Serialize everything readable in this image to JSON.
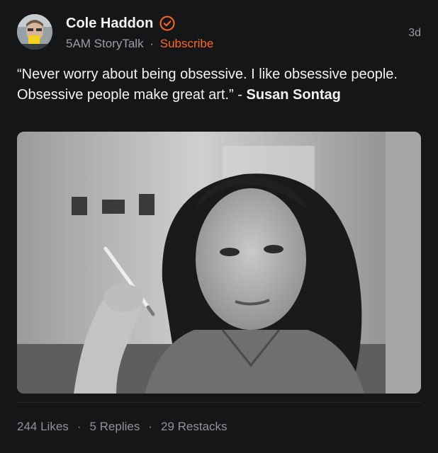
{
  "author": {
    "name": "Cole Haddon",
    "publication": "5AM StoryTalk",
    "subscribe_label": "Subscribe",
    "separator": "·"
  },
  "timestamp": "3d",
  "post": {
    "quote": "“Never worry about being obsessive. I like obsessive people. Obsessive people make great art.” - ",
    "attribution": "Susan Sontag"
  },
  "stats": {
    "likes": "244 Likes",
    "replies": "5 Replies",
    "restacks": "29 Restacks",
    "separator": "·"
  },
  "colors": {
    "background": "#151618",
    "accent": "#ff6719",
    "muted": "#9a9da3"
  },
  "icons": {
    "verified": "verified-badge-icon"
  }
}
